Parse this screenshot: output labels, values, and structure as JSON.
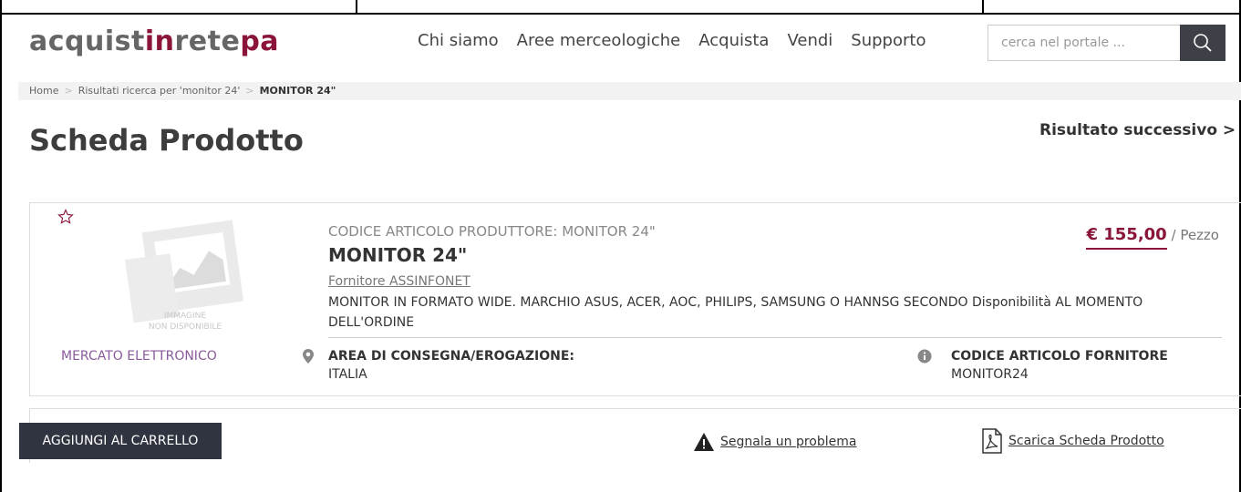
{
  "logo": {
    "part1": "acquist",
    "part2": "in",
    "part3": "rete",
    "part4": "pa"
  },
  "nav": [
    "Chi siamo",
    "Aree merceologiche",
    "Acquista",
    "Vendi",
    "Supporto"
  ],
  "search": {
    "placeholder": "cerca nel portale ..."
  },
  "breadcrumb": {
    "home": "Home",
    "results": "Risultati ricerca per 'monitor 24'",
    "current": "MONITOR 24\""
  },
  "page": {
    "title": "Scheda Prodotto",
    "next_result": "Risultato successivo >"
  },
  "product": {
    "image_text_1": "IMMAGINE",
    "image_text_2": "NON DISPONIBILE",
    "code_label": "CODICE ARTICOLO PRODUTTORE: MONITOR 24\"",
    "title": "MONITOR 24\"",
    "supplier": "Fornitore ASSINFONET",
    "description": "MONITOR IN FORMATO WIDE. MARCHIO ASUS, ACER, AOC, PHILIPS, SAMSUNG O HANNSG SECONDO Disponibilità AL MOMENTO DELL'ORDINE",
    "price": "€ 155,00",
    "unit": "/ Pezzo",
    "market": "MERCATO ELETTRONICO",
    "area_label": "AREA DI CONSEGNA/EROGAZIONE:",
    "area_value": "ITALIA",
    "supplier_code_label": "CODICE ARTICOLO FORNITORE",
    "supplier_code_value": "MONITOR24"
  },
  "actions": {
    "add_to_cart": "AGGIUNGI AL CARRELLO",
    "report": "Segnala un problema",
    "download": "Scarica Scheda Prodotto"
  },
  "colors": {
    "brand": "#8a1538",
    "dark": "#2f3440",
    "market": "#8a5a9c"
  }
}
